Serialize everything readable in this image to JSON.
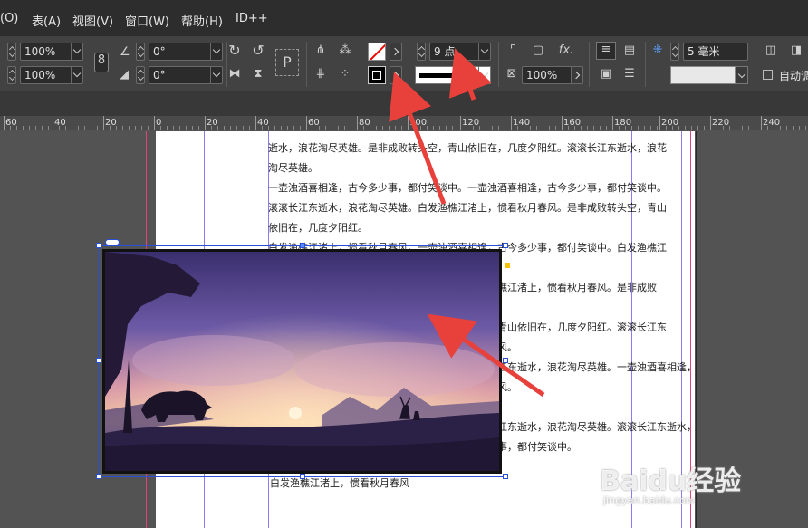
{
  "menu": [
    "(O)",
    "表(A)",
    "视图(V)",
    "窗口(W)",
    "帮助(H)",
    "ID++"
  ],
  "control": {
    "scale_x": "100%",
    "scale_y": "100%",
    "rotate_angle": "0°",
    "shear_angle": "0°",
    "stroke_weight": "9 点",
    "opacity": "100%",
    "gap_value": "5 毫米",
    "auto_fit_label": "自动调"
  },
  "ruler": {
    "labels": [
      "60",
      "40",
      "20",
      "0",
      "20",
      "40",
      "60",
      "80",
      "100",
      "120",
      "140",
      "160",
      "180",
      "200",
      "220",
      "240"
    ]
  },
  "document": {
    "text_lines": [
      "逝水，浪花淘尽英雄。是非成败转头空，青山依旧在，几度夕阳红。滚滚长江东逝水，浪花",
      "淘尽英雄。",
      "一壶浊酒喜相逢，古今多少事，都付笑谈中。一壶浊酒喜相逢，古今多少事，都付笑谈中。",
      "滚滚长江东逝水，浪花淘尽英雄。白发渔樵江渚上，惯看秋月春风。是非成败转头空，青山",
      "依旧在，几度夕阳红。",
      "白发渔樵江渚上，惯看秋月春风。一壶浊酒喜相逢，古今多少事，都付笑谈中。白发渔樵江",
      "渚上，惯看秋月春风。",
      "是非成败转头空，青山依旧在，几度夕阳红。白发渔樵江渚上，惯看秋月春风。是非成败",
      "转头空，青山依旧在，几度夕阳红。",
      "滚滚长江东逝水，浪花淘尽英雄。是非成败转头空，青山依旧在，几度夕阳红。滚滚长江东",
      "逝水，浪花淘尽英雄。白发渔樵江渚上，惯看秋月春风。",
      "一壶浊酒喜相逢，古今多少事，都付笑谈中。滚滚长江东逝水，浪花淘尽英雄。一壶浊酒喜相逢，古今",
      "多少事，都付笑谈中。白发渔樵江渚上，惯看秋月春风。",
      "",
      "是非成败转头空，青山依旧在，几度夕阳红。滚滚长江东逝水，浪花淘尽英雄。滚滚长江东逝水，浪花",
      "淘尽英雄。几度夕阳红。一壶浊酒喜相逢，古今多少事，都付笑谈中。"
    ],
    "last_line": "白发渔樵江渚上，惯看秋月春风"
  },
  "watermark": {
    "brand": "Baidu经验",
    "url": "jingyan.baidu.com"
  },
  "colors": {
    "annotation_arrow": "#e8403a",
    "selection": "#2a4fd8",
    "guide_magenta": "#e0447a",
    "guide_violet": "#8a7cf0"
  }
}
